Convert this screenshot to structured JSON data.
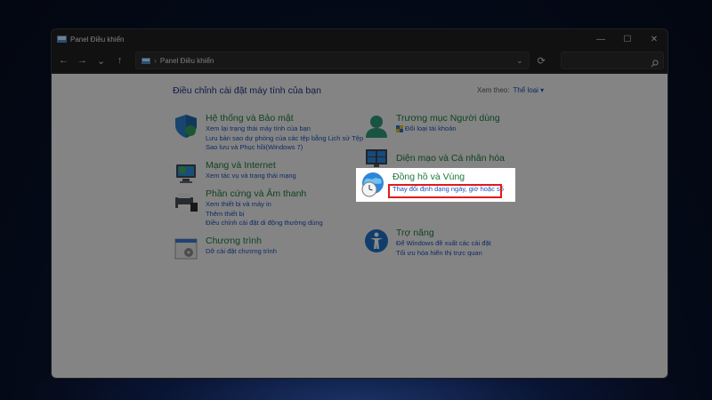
{
  "window": {
    "title": "Panel Điều khiển",
    "minimize": "—",
    "maximize": "☐",
    "close": "✕"
  },
  "nav": {
    "back": "←",
    "forward": "→",
    "recent": "⌄",
    "up": "↑",
    "address_sep": "›",
    "address": "Panel Điều khiển",
    "address_chevron": "⌄",
    "refresh": "⟳"
  },
  "main": {
    "heading": "Điều chỉnh cài đặt máy tính của bạn",
    "view_by_label": "Xem theo:",
    "view_by_value": "Thể loại ▾"
  },
  "categories": {
    "system": {
      "title": "Hệ thống và Bảo mật",
      "links": [
        "Xem lại trạng thái máy tính của bạn",
        "Lưu bản sao dự phòng của các tệp bằng Lịch sử Tệp",
        "Sao lưu và Phục hồi(Windows 7)"
      ]
    },
    "network": {
      "title": "Mạng và Internet",
      "links": [
        "Xem tác vụ và trạng thái mạng"
      ]
    },
    "hardware": {
      "title": "Phần cứng và Âm thanh",
      "links": [
        "Xem thiết bị và máy in",
        "Thêm thiết bị",
        "Điều chỉnh cài đặt di động thường dùng"
      ]
    },
    "programs": {
      "title": "Chương trình",
      "links": [
        "Dỡ cài đặt chương trình"
      ]
    },
    "users": {
      "title": "Trương mục Người dùng",
      "links": [
        "Đổi loại tài khoản"
      ]
    },
    "appearance": {
      "title": "Diện mạo và Cá nhân hóa",
      "links": []
    },
    "clock": {
      "title": "Đồng hồ và Vùng",
      "links": [
        "Thay đổi định dạng ngày, giờ hoặc số"
      ]
    },
    "ease": {
      "title": "Trợ năng",
      "links": [
        "Để Windows đề xuất các cài đặt",
        "Tối ưu hóa hiển thị trực quan"
      ]
    }
  },
  "colors": {
    "category_title": "#1b7a3b",
    "link": "#1e4fb8",
    "highlight_border": "#e01b1b"
  }
}
